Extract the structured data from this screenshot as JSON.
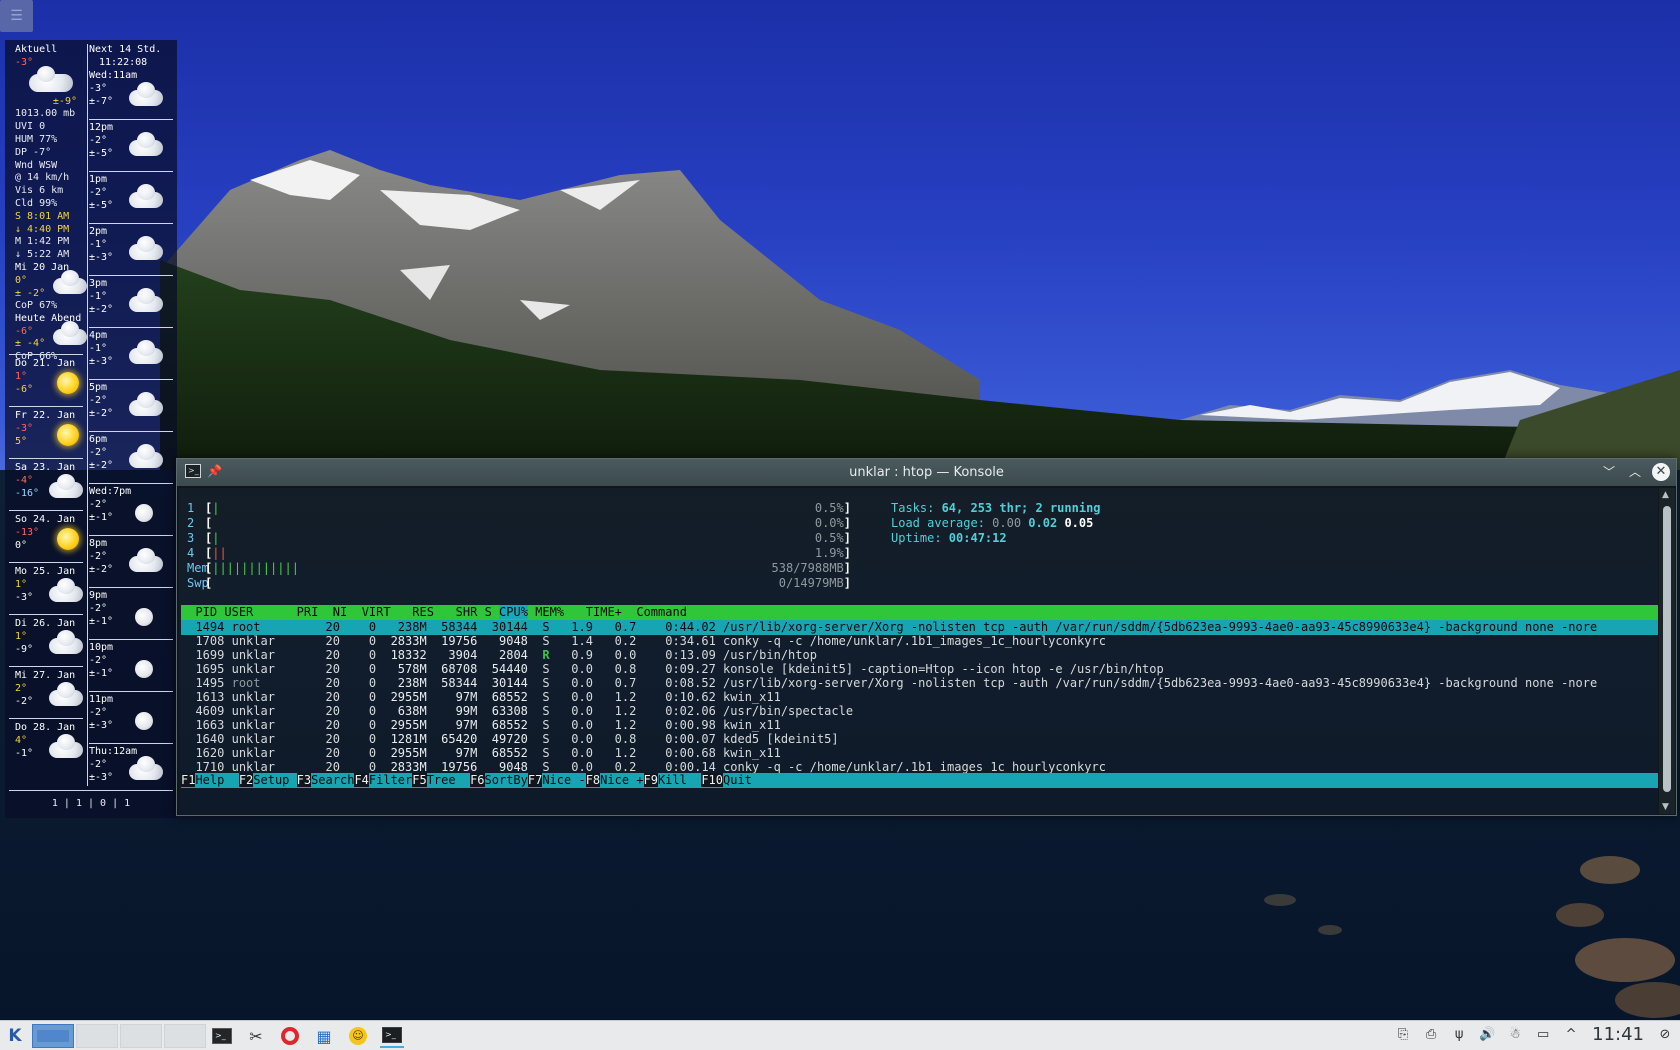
{
  "top_menu": {
    "icon": "menu-icon",
    "glyph": "☰"
  },
  "conky": {
    "current": {
      "title": "Aktuell",
      "temp": "-3°",
      "feels": "±-9°",
      "pressure": "1013.00 mb",
      "uvi": "UVI 0",
      "hum": "HUM 77%",
      "dp": "DP  -7°",
      "wind_dir": "Wnd WSW",
      "wind_speed": "@ 14 km/h",
      "visibility": "Vis 6 km",
      "cloud": "Cld 99%",
      "sunrise": "S 8:01 AM",
      "sunset": "↓ 4:40 PM",
      "moon": "M 1:42 PM",
      "moonset": "↓ 5:22 AM"
    },
    "daily": [
      {
        "day": "Mi 20 Jan",
        "high": "0°",
        "low": "± -2°",
        "extra1": "CoP  67%",
        "icon": "cloud-icon"
      },
      {
        "day": "Heute Abend",
        "high": "-6°",
        "low": "± -4°",
        "extra1": "CoP  66%",
        "icon": "cloud-icon"
      },
      {
        "day": "Do 21. Jan",
        "high": "1°",
        "low": "-6°",
        "icon": "sun-icon"
      },
      {
        "day": "Fr 22. Jan",
        "high": "-3°",
        "low": "5°",
        "icon": "sun-icon"
      },
      {
        "day": "Sa 23. Jan",
        "high": "-4°",
        "low": "-16°",
        "icon": "cloud-icon"
      },
      {
        "day": "So 24. Jan",
        "high": "-13°",
        "low": "0°",
        "icon": "sun-icon"
      },
      {
        "day": "Mo 25. Jan",
        "high": "1°",
        "low": "-3°",
        "icon": "cloud-icon"
      },
      {
        "day": "Di 26. Jan",
        "high": "1°",
        "low": "-9°",
        "icon": "cloud-icon"
      },
      {
        "day": "Mi 27. Jan",
        "high": "2°",
        "low": "-2°",
        "icon": "cloud-icon"
      },
      {
        "day": "Do 28. Jan",
        "high": "4°",
        "low": "-1°",
        "icon": "cloud-icon"
      }
    ],
    "hourly_header": {
      "title": "Next 14 Std.",
      "time": "11:22:08"
    },
    "hourly": [
      {
        "time": "Wed:11am",
        "temp": "-3°",
        "feels": "±-7°",
        "icon": "cloud-icon"
      },
      {
        "time": "12pm",
        "temp": "-2°",
        "feels": "±-5°",
        "icon": "cloud-icon"
      },
      {
        "time": "1pm",
        "temp": "-2°",
        "feels": "±-5°",
        "icon": "cloud-icon"
      },
      {
        "time": "2pm",
        "temp": "-1°",
        "feels": "±-3°",
        "icon": "cloud-icon"
      },
      {
        "time": "3pm",
        "temp": "-1°",
        "feels": "±-2°",
        "icon": "cloud-icon"
      },
      {
        "time": "4pm",
        "temp": "-1°",
        "feels": "±-3°",
        "icon": "cloud-icon"
      },
      {
        "time": "5pm",
        "temp": "-2°",
        "feels": "±-2°",
        "icon": "cloud-icon"
      },
      {
        "time": "6pm",
        "temp": "-2°",
        "feels": "±-2°",
        "icon": "cloud-icon"
      },
      {
        "time": "Wed:7pm",
        "temp": "-2°",
        "feels": "±-1°",
        "icon": "moon-icon"
      },
      {
        "time": "8pm",
        "temp": "-2°",
        "feels": "±-2°",
        "icon": "cloud-icon"
      },
      {
        "time": "9pm",
        "temp": "-2°",
        "feels": "±-1°",
        "icon": "moon-icon"
      },
      {
        "time": "10pm",
        "temp": "-2°",
        "feels": "±-1°",
        "icon": "moon-icon"
      },
      {
        "time": "11pm",
        "temp": "-2°",
        "feels": "±-3°",
        "icon": "moon-icon"
      },
      {
        "time": "Thu:12am",
        "temp": "-2°",
        "feels": "±-3°",
        "icon": "cloud-icon"
      }
    ],
    "footer": "1 | 1 | 0 | 1"
  },
  "konsole": {
    "title": "unklar : htop — Konsole",
    "icons": {
      "app": "terminal-icon",
      "pin": "pin-icon",
      "minimize": "chevron-down-icon",
      "maximize": "chevron-up-icon",
      "close": "close-icon"
    },
    "glyphs": {
      "pin": "📌",
      "minimize": "﹀",
      "maximize": "︿",
      "close": "✕"
    },
    "meters": [
      {
        "label": "1",
        "bar": "|",
        "bar_color": "green",
        "value": "0.5%"
      },
      {
        "label": "2",
        "bar": "",
        "bar_color": "green",
        "value": "0.0%"
      },
      {
        "label": "3",
        "bar": "|",
        "bar_color": "green",
        "value": "0.5%"
      },
      {
        "label": "4",
        "bar": "||",
        "bar_color": "red",
        "value": "1.9%"
      },
      {
        "label": "Mem",
        "bar": "||||||||||||",
        "bar_color": "green",
        "value": "538/7988MB"
      },
      {
        "label": "Swp",
        "bar": "",
        "bar_color": "red",
        "value": "0/14979MB"
      }
    ],
    "stats": {
      "tasks_label": "Tasks: ",
      "tasks_value": "64, 253 thr; 2 running",
      "load_label": "Load average: ",
      "load_1": "0.00",
      "load_5": "0.02",
      "load_15": "0.05",
      "uptime_label": "Uptime: ",
      "uptime_value": "00:47:12"
    },
    "columns": [
      "PID",
      "USER",
      "PRI",
      "NI",
      "VIRT",
      "RES",
      "SHR",
      "S",
      "CPU%",
      "MEM%",
      "TIME+",
      "Command"
    ],
    "sorted_column": "CPU%",
    "processes": [
      {
        "pid": "1494",
        "user": "root",
        "pri": "20",
        "ni": "0",
        "virt": "238M",
        "res": "58344",
        "shr": "30144",
        "s": "S",
        "cpu": "1.9",
        "mem": "0.7",
        "time": "0:44.02",
        "cmd": "/usr/lib/xorg-server/Xorg -nolisten tcp -auth /var/run/sddm/{5db623ea-9993-4ae0-aa93-45c8990633e4} -background none -nore",
        "selected": true
      },
      {
        "pid": "1708",
        "user": "unklar",
        "pri": "20",
        "ni": "0",
        "virt": "2833M",
        "res": "19756",
        "shr": "9048",
        "s": "S",
        "cpu": "1.4",
        "mem": "0.2",
        "time": "0:34.61",
        "cmd": "conky -q -c /home/unklar/.1b1_images_1c_hourlyconkyrc"
      },
      {
        "pid": "1699",
        "user": "unklar",
        "pri": "20",
        "ni": "0",
        "virt": "18332",
        "res": "3904",
        "shr": "2804",
        "s": "R",
        "cpu": "0.9",
        "mem": "0.0",
        "time": "0:13.09",
        "cmd": "/usr/bin/htop"
      },
      {
        "pid": "1695",
        "user": "unklar",
        "pri": "20",
        "ni": "0",
        "virt": "578M",
        "res": "68708",
        "shr": "54440",
        "s": "S",
        "cpu": "0.0",
        "mem": "0.8",
        "time": "0:09.27",
        "cmd": "konsole [kdeinit5] -caption=Htop --icon htop -e /usr/bin/htop"
      },
      {
        "pid": "1495",
        "user": "root",
        "pri": "20",
        "ni": "0",
        "virt": "238M",
        "res": "58344",
        "shr": "30144",
        "s": "S",
        "cpu": "0.0",
        "mem": "0.7",
        "time": "0:08.52",
        "cmd": "/usr/lib/xorg-server/Xorg -nolisten tcp -auth /var/run/sddm/{5db623ea-9993-4ae0-aa93-45c8990633e4} -background none -nore"
      },
      {
        "pid": "1613",
        "user": "unklar",
        "pri": "20",
        "ni": "0",
        "virt": "2955M",
        "res": "97M",
        "shr": "68552",
        "s": "S",
        "cpu": "0.0",
        "mem": "1.2",
        "time": "0:10.62",
        "cmd": "kwin_x11"
      },
      {
        "pid": "4609",
        "user": "unklar",
        "pri": "20",
        "ni": "0",
        "virt": "638M",
        "res": "99M",
        "shr": "63308",
        "s": "S",
        "cpu": "0.0",
        "mem": "1.2",
        "time": "0:02.06",
        "cmd": "/usr/bin/spectacle"
      },
      {
        "pid": "1663",
        "user": "unklar",
        "pri": "20",
        "ni": "0",
        "virt": "2955M",
        "res": "97M",
        "shr": "68552",
        "s": "S",
        "cpu": "0.0",
        "mem": "1.2",
        "time": "0:00.98",
        "cmd": "kwin_x11"
      },
      {
        "pid": "1640",
        "user": "unklar",
        "pri": "20",
        "ni": "0",
        "virt": "1281M",
        "res": "65420",
        "shr": "49720",
        "s": "S",
        "cpu": "0.0",
        "mem": "0.8",
        "time": "0:00.07",
        "cmd": "kded5 [kdeinit5]"
      },
      {
        "pid": "1620",
        "user": "unklar",
        "pri": "20",
        "ni": "0",
        "virt": "2955M",
        "res": "97M",
        "shr": "68552",
        "s": "S",
        "cpu": "0.0",
        "mem": "1.2",
        "time": "0:00.68",
        "cmd": "kwin_x11"
      },
      {
        "pid": "1710",
        "user": "unklar",
        "pri": "20",
        "ni": "0",
        "virt": "2833M",
        "res": "19756",
        "shr": "9048",
        "s": "S",
        "cpu": "0.0",
        "mem": "0.2",
        "time": "0:00.14",
        "cmd": "conky -q -c /home/unklar/.1b1_images_1c_hourlyconkyrc"
      }
    ],
    "fkeys": [
      {
        "key": "F1",
        "label": "Help  "
      },
      {
        "key": "F2",
        "label": "Setup "
      },
      {
        "key": "F3",
        "label": "Search"
      },
      {
        "key": "F4",
        "label": "Filter"
      },
      {
        "key": "F5",
        "label": "Tree  "
      },
      {
        "key": "F6",
        "label": "SortBy"
      },
      {
        "key": "F7",
        "label": "Nice -"
      },
      {
        "key": "F8",
        "label": "Nice +"
      },
      {
        "key": "F9",
        "label": "Kill  "
      },
      {
        "key": "F10",
        "label": "Quit"
      }
    ]
  },
  "taskbar": {
    "kmenu_glyph": "K",
    "pager": [
      "desktop-1",
      "desktop-2",
      "desktop-3",
      "desktop-4"
    ],
    "launchers": [
      {
        "name": "terminal-launcher",
        "icon": "terminal-icon",
        "glyph": ">_"
      },
      {
        "name": "tools-launcher",
        "icon": "tools-icon",
        "glyph": "✂"
      },
      {
        "name": "opera-launcher",
        "icon": "opera-icon",
        "glyph": ""
      },
      {
        "name": "calculator-launcher",
        "icon": "calculator-icon",
        "glyph": "▦"
      },
      {
        "name": "emoji-launcher",
        "icon": "smiley-icon",
        "glyph": "☺"
      },
      {
        "name": "konsole-task",
        "icon": "konsole-icon",
        "glyph": ">_"
      }
    ],
    "tray": [
      {
        "name": "clipboard-icon",
        "glyph": "⎘"
      },
      {
        "name": "printer-icon",
        "glyph": "⎙"
      },
      {
        "name": "usb-icon",
        "glyph": "ψ"
      },
      {
        "name": "volume-icon",
        "glyph": "🔊"
      },
      {
        "name": "ghost-icon",
        "glyph": "☃"
      },
      {
        "name": "display-icon",
        "glyph": "▭"
      },
      {
        "name": "expand-tray-icon",
        "glyph": "^"
      }
    ],
    "clock": "11:41",
    "end_icon": {
      "name": "show-desktop-icon",
      "glyph": "⊘"
    }
  }
}
